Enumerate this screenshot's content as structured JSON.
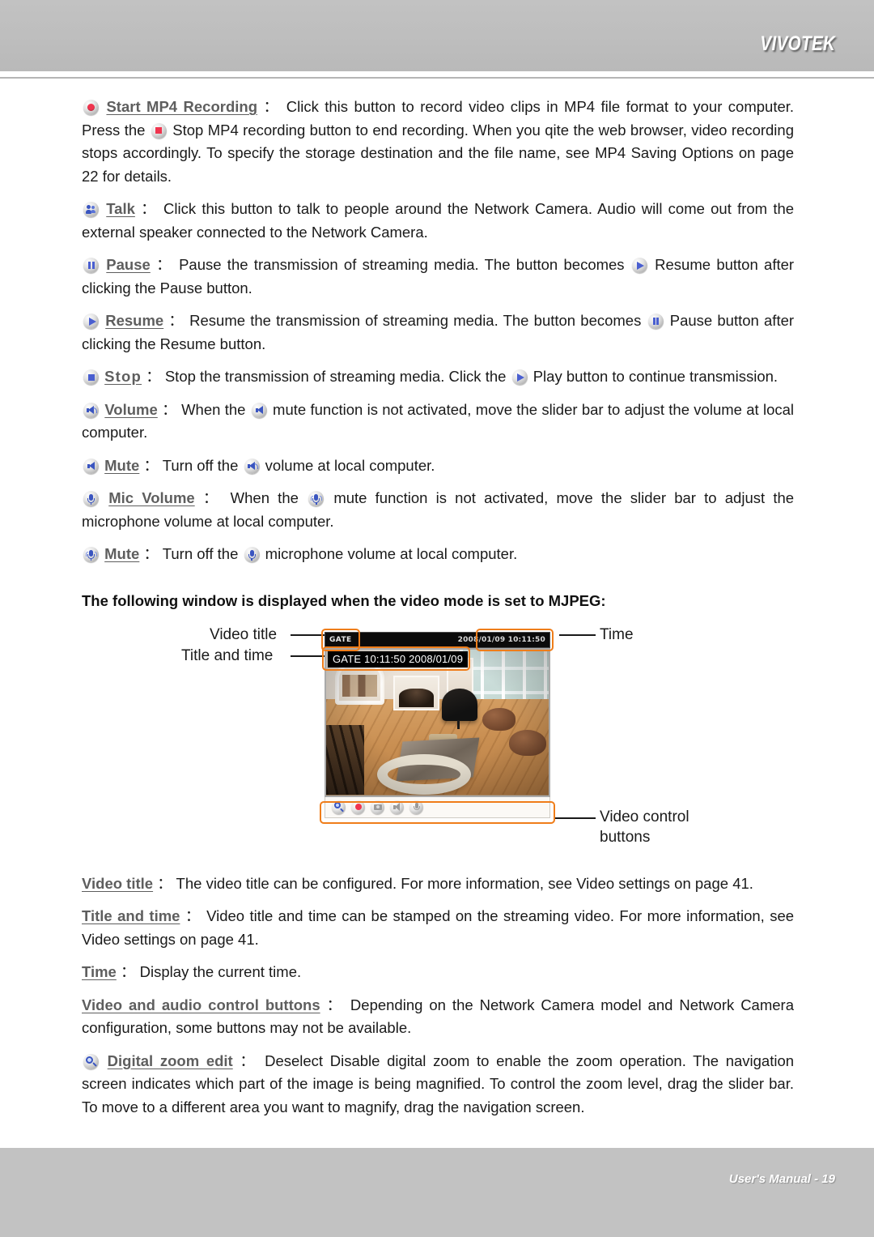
{
  "header": {
    "brand": "VIVOTEK"
  },
  "footer": {
    "text": "User's Manual - 19"
  },
  "paragraphs": {
    "mp4": {
      "term": "Start MP4 Recording",
      "colon": "：",
      "t1": "Click this button to record video clips in MP4 file format to your computer. Press the",
      "t2": "Stop MP4 recording button to end recording. When you qite the web browser, video recording stops accordingly. To specify the storage destination and the file name, see MP4 Saving Options on page 22 for details."
    },
    "talk": {
      "term": "Talk",
      "colon": "：",
      "t1": "Click this button to talk to people around the Network Camera. Audio will come out from the external speaker connected to the Network Camera."
    },
    "pause": {
      "term": "Pause",
      "colon": "：",
      "t1": "Pause the transmission of streaming media. The button becomes",
      "t2": "Resume button after clicking the Pause button."
    },
    "resume": {
      "term": "Resume",
      "colon": "：",
      "t1": "Resume the transmission of streaming media. The button becomes",
      "t2": "Pause button after clicking the Resume button."
    },
    "stop": {
      "term": "Stop",
      "colon": "：",
      "t1": "Stop the transmission of streaming media. Click the",
      "t2": "Play button to continue transmission."
    },
    "volume": {
      "term": "Volume",
      "colon": "：",
      "t1": "When the",
      "t2": "mute function is not activated, move the slider bar to adjust the volume at local computer."
    },
    "mute": {
      "term": "Mute",
      "colon": "：",
      "t1": "Turn off the",
      "t2": "volume at local computer."
    },
    "micvolume": {
      "term": "Mic Volume",
      "colon": "：",
      "t1": "When the",
      "t2": "mute function is not activated, move the slider bar to adjust the microphone volume at local computer."
    },
    "micmute": {
      "term": "Mute",
      "colon": "：",
      "t1": "Turn off the",
      "t2": "microphone volume at local computer."
    },
    "videotitle": {
      "term": "Video title",
      "colon": "：",
      "t1": "The video title can be configured. For more information, see Video settings on page 41."
    },
    "titleandtime": {
      "term": "Title and time",
      "colon": "：",
      "t1": "Video title and time can be stamped on the streaming video. For more information, see Video settings on page 41."
    },
    "time": {
      "term": "Time",
      "colon": "：",
      "t1": "Display the current time."
    },
    "controlbuttons": {
      "term": "Video and audio control buttons",
      "colon": "：",
      "t1": "Depending on the Network Camera model and Network Camera configuration, some buttons may not be available."
    },
    "digitalzoom": {
      "term": "Digital zoom edit",
      "colon": "：",
      "t1": "Deselect Disable digital zoom to enable the zoom operation. The navigation screen indicates which part of the image is being magnified. To control the zoom level, drag the slider bar. To move to a different area you want to magnify, drag the navigation screen."
    }
  },
  "mjpeg_section": {
    "heading": "The following window is displayed when the video mode is set to MJPEG:",
    "labels": {
      "video_title": "Video title",
      "title_and_time": "Title and time",
      "time": "Time",
      "video_control_buttons_l1": "Video control",
      "video_control_buttons_l2": "buttons"
    },
    "screenshot": {
      "titlebar_name": "GATE",
      "titlebar_time": "2008/01/09 10:11:50",
      "osd_stamp": "GATE 10:11:50  2008/01/09",
      "control_buttons": [
        "digital-zoom-icon",
        "record-icon",
        "snapshot-icon",
        "volume-icon",
        "microphone-icon"
      ]
    }
  },
  "colors": {
    "header_gray": "#c2c2c2",
    "term_gray": "#5e5e5e",
    "highlight_orange": "#ef7d1a",
    "icon_blue": "#3a55c0",
    "record_red": "#f0354f"
  }
}
